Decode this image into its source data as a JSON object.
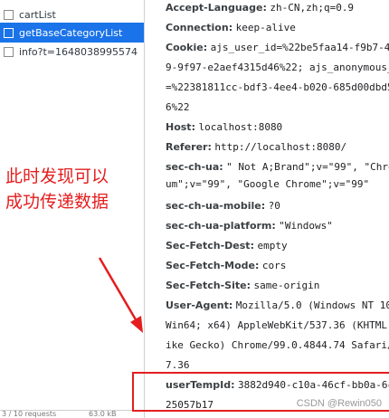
{
  "request_list": [
    {
      "name": "cartList",
      "selected": false
    },
    {
      "name": "getBaseCategoryList",
      "selected": true
    },
    {
      "name": "info?t=1648038995574",
      "selected": false
    }
  ],
  "annotation": {
    "line1": "此时发现可以",
    "line2": "成功传递数据"
  },
  "headers": [
    {
      "key": "Accept-Language:",
      "value": "zh-CN,zh;q=0.9",
      "cont": []
    },
    {
      "key": "Connection:",
      "value": "keep-alive",
      "cont": []
    },
    {
      "key": "Cookie:",
      "value": "ajs_user_id=%22be5faa14-f9b7-4",
      "cont": [
        "9-9f97-e2aef4315d46%22; ajs_anonymous_",
        "=%22381811cc-bdf3-4ee4-b020-685d00dbd5",
        "6%22"
      ]
    },
    {
      "key": "Host:",
      "value": "localhost:8080",
      "cont": []
    },
    {
      "key": "Referer:",
      "value": "http://localhost:8080/",
      "cont": []
    },
    {
      "key": "sec-ch-ua:",
      "value": "\" Not A;Brand\";v=\"99\", \"Chro",
      "cont": [
        "um\";v=\"99\", \"Google Chrome\";v=\"99\""
      ]
    },
    {
      "key": "sec-ch-ua-mobile:",
      "value": "?0",
      "cont": []
    },
    {
      "key": "sec-ch-ua-platform:",
      "value": "\"Windows\"",
      "cont": []
    },
    {
      "key": "Sec-Fetch-Dest:",
      "value": "empty",
      "cont": []
    },
    {
      "key": "Sec-Fetch-Mode:",
      "value": "cors",
      "cont": []
    },
    {
      "key": "Sec-Fetch-Site:",
      "value": "same-origin",
      "cont": []
    },
    {
      "key": "User-Agent:",
      "value": "Mozilla/5.0 (Windows NT 10",
      "cont": [
        "Win64; x64) AppleWebKit/537.36 (KHTML,",
        "ike Gecko) Chrome/99.0.4844.74 Safari/",
        "7.36"
      ]
    },
    {
      "key": "userTempId:",
      "value": "3882d940-c10a-46cf-bb0a-6c",
      "cont": [
        "25057b17"
      ]
    }
  ],
  "status_bar": {
    "left": "3 / 10 requests",
    "right": "63.0 kB"
  },
  "watermark": "CSDN @Rewin050",
  "colors": {
    "selection": "#1a73e8",
    "annotation": "#e41e1e"
  }
}
